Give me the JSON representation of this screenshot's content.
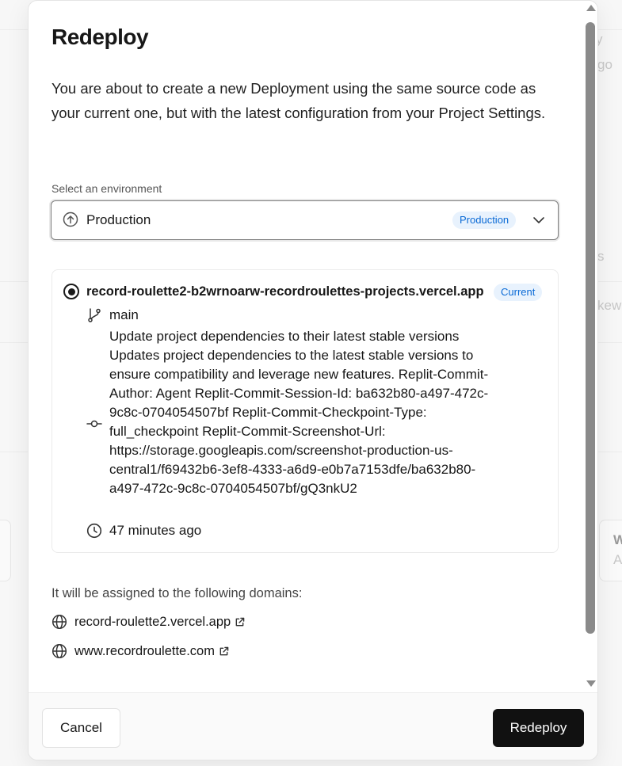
{
  "modal": {
    "title": "Redeploy",
    "description": "You are about to create a new Deployment using the same source code as your current one, but with the latest configuration from your Project Settings.",
    "environment": {
      "label": "Select an environment",
      "selected": "Production",
      "badge": "Production"
    },
    "deployment": {
      "name": "record-roulette2-b2wrnoarw-recordroulettes-projects.vercel.app",
      "badge": "Current",
      "branch": "main",
      "commit_message": "Update project dependencies to their latest stable versions Updates project dependencies to the latest stable versions to ensure compatibility and leverage new features. Replit-Commit-Author: Agent Replit-Commit-Session-Id: ba632b80-a497-472c-9c8c-0704054507bf Replit-Commit-Checkpoint-Type: full_checkpoint Replit-Commit-Screenshot-Url: https://storage.googleapis.com/screenshot-production-us-central1/f69432b6-3ef8-4333-a6d9-e0b7a7153dfe/ba632b80-a497-472c-9c8c-0704054507bf/gQ3nkU2",
      "time": "47 minutes ago"
    },
    "domains_label": "It will be assigned to the following domains:",
    "domains": [
      "record-roulette2.vercel.app",
      "www.recordroulette.com"
    ],
    "footer": {
      "cancel_label": "Cancel",
      "redeploy_label": "Redeploy"
    }
  },
  "background": {
    "fragments": [
      "y",
      "go",
      "s",
      "kew",
      "W",
      "A"
    ]
  },
  "colors": {
    "badge_text": "#0a6ad6",
    "badge_bg": "#e8f2fd",
    "primary_button": "#111111"
  }
}
